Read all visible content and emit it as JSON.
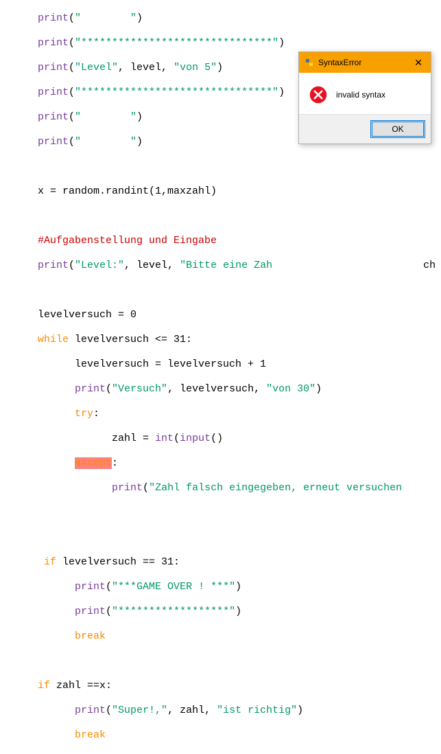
{
  "code": {
    "l1": {
      "a": "print",
      "b": "(",
      "c": "\"        \"",
      "d": ")"
    },
    "l2": {
      "a": "print",
      "b": "(",
      "c": "\"*******************************\"",
      "d": ")"
    },
    "l3": {
      "a": "print",
      "b": "(",
      "c": "\"Level\"",
      "d": ", level, ",
      "e": "\"von 5\"",
      "f": ")"
    },
    "l4": {
      "a": "print",
      "b": "(",
      "c": "\"*******************************\"",
      "d": ")"
    },
    "l5": {
      "a": "print",
      "b": "(",
      "c": "\"        \"",
      "d": ")"
    },
    "l6": {
      "a": "print",
      "b": "(",
      "c": "\"        \"",
      "d": ")"
    },
    "l8": "x = random.randint(1,maxzahl)",
    "l10": "#Aufgabenstellung und Eingabe",
    "l11": {
      "a": "print",
      "b": "(",
      "c": "\"Level:\"",
      "d": ", level, ",
      "e": "\"Bitte eine Zah",
      "tail": "ch"
    },
    "l13": "levelversuch = 0",
    "l14": {
      "a": "while",
      "b": " levelversuch <= 31:"
    },
    "l15": "      levelversuch = levelversuch + 1",
    "l16": {
      "pad": "      ",
      "a": "print",
      "b": "(",
      "c": "\"Versuch\"",
      "d": ", levelversuch, ",
      "e": "\"von 30\"",
      "f": ")"
    },
    "l17": {
      "pad": "      ",
      "a": "try",
      "b": ":"
    },
    "l18": {
      "pad": "            ",
      "a": "zahl = ",
      "b": "int",
      "c": "(",
      "d": "input",
      "e": "()"
    },
    "l19": {
      "pad": "      ",
      "a": "except",
      "b": ":"
    },
    "l20": {
      "pad": "            ",
      "a": "print",
      "b": "(",
      "c": "\"Zahl falsch eingegeben, erneut versuchen"
    },
    "l23": {
      "pad": " ",
      "a": "if",
      "b": " levelversuch == 31:"
    },
    "l24": {
      "pad": "      ",
      "a": "print",
      "b": "(",
      "c": "\"***GAME OVER ! ***\"",
      "d": ")"
    },
    "l25": {
      "pad": "      ",
      "a": "print",
      "b": "(",
      "c": "\"******************\"",
      "d": ")"
    },
    "l26": {
      "pad": "      ",
      "a": "break"
    },
    "l28": {
      "a": "if",
      "b": " zahl ==x:"
    },
    "l29": {
      "pad": "      ",
      "a": "print",
      "b": "(",
      "c": "\"Super!,\"",
      "d": ", zahl, ",
      "e": "\"ist richtig\"",
      "f": ")"
    },
    "l30": {
      "pad": "      ",
      "a": "break"
    }
  },
  "dialog": {
    "title": "SyntaxError",
    "message": "invalid syntax",
    "ok": "OK"
  }
}
